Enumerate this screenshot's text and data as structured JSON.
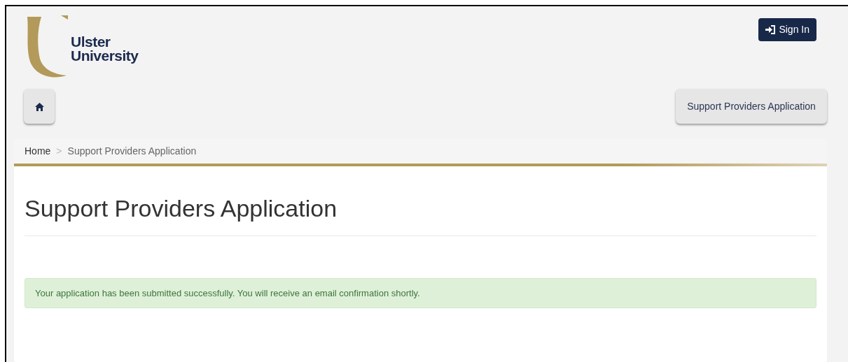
{
  "header": {
    "logo_lines": [
      "Ulster",
      "University"
    ],
    "sign_in": "Sign In"
  },
  "nav": {
    "items": [
      {
        "kind": "home"
      },
      {
        "kind": "text",
        "label": "Support Providers Application"
      }
    ]
  },
  "breadcrumb": [
    "Home",
    "Support Providers Application"
  ],
  "breadcrumb_separator": ">",
  "page": {
    "title": "Support Providers Application",
    "alert": {
      "kind": "success",
      "text": "Your application has been submitted successfully. You will receive an email confirmation shortly."
    }
  }
}
